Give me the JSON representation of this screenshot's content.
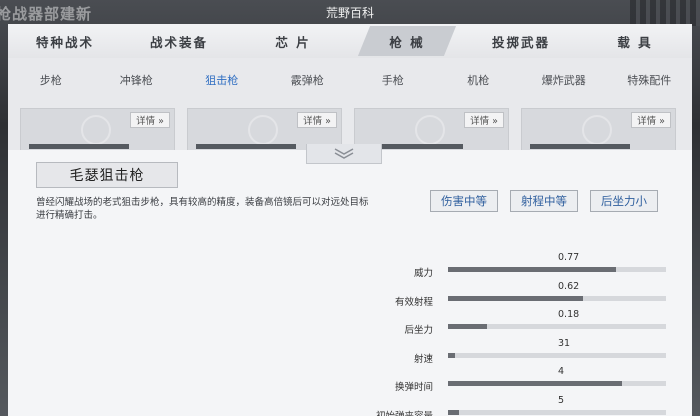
{
  "background": {
    "left_text": "枪战器部建新"
  },
  "window": {
    "title": "荒野百科"
  },
  "top_tabs": [
    {
      "label": "特种战术",
      "active": false
    },
    {
      "label": "战术装备",
      "active": false
    },
    {
      "label": "芯 片",
      "active": false
    },
    {
      "label": "枪 械",
      "active": true
    },
    {
      "label": "投掷武器",
      "active": false
    },
    {
      "label": "载 具",
      "active": false
    }
  ],
  "sub_tabs": [
    {
      "label": "步枪",
      "active": false
    },
    {
      "label": "冲锋枪",
      "active": false
    },
    {
      "label": "狙击枪",
      "active": true
    },
    {
      "label": "霰弹枪",
      "active": false
    },
    {
      "label": "手枪",
      "active": false
    },
    {
      "label": "机枪",
      "active": false
    },
    {
      "label": "爆炸武器",
      "active": false
    },
    {
      "label": "特殊配件",
      "active": false
    }
  ],
  "cards": {
    "detail_label": "详情 »",
    "count": 4
  },
  "detail": {
    "weapon_name": "毛瑟狙击枪",
    "description": "曾经闪耀战场的老式狙击步枪，具有较高的精度，装备高倍镜后可以对远处目标进行精确打击。",
    "tags": [
      "伤害中等",
      "射程中等",
      "后坐力小"
    ],
    "stats": [
      {
        "label": "威力",
        "value": "0.77",
        "fraction": 0.77
      },
      {
        "label": "有效射程",
        "value": "0.62",
        "fraction": 0.62
      },
      {
        "label": "后坐力",
        "value": "0.18",
        "fraction": 0.18
      },
      {
        "label": "射速",
        "value": "31",
        "fraction": 0.03
      },
      {
        "label": "换弹时间",
        "value": "4",
        "fraction": 0.8
      },
      {
        "label": "初始弹夹容量",
        "value": "5",
        "fraction": 0.05
      }
    ]
  }
}
